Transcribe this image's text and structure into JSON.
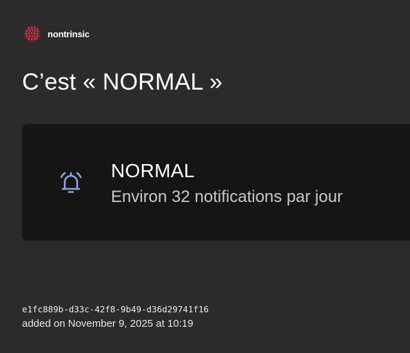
{
  "brand": {
    "name": "nontrinsic",
    "logo_icon": "dotted-globe-logo",
    "logo_color": "#e0344f"
  },
  "title": "C’est « NORMAL »",
  "card": {
    "icon": "bell-ringing-icon",
    "icon_color": "#8fa6e3",
    "level": "NORMAL",
    "description": "Environ 32 notifications par jour"
  },
  "meta": {
    "uuid": "e1fc889b-d33c-42f8-9b49-d36d29741f16",
    "added": "added on November 9, 2025 at 10:19"
  }
}
